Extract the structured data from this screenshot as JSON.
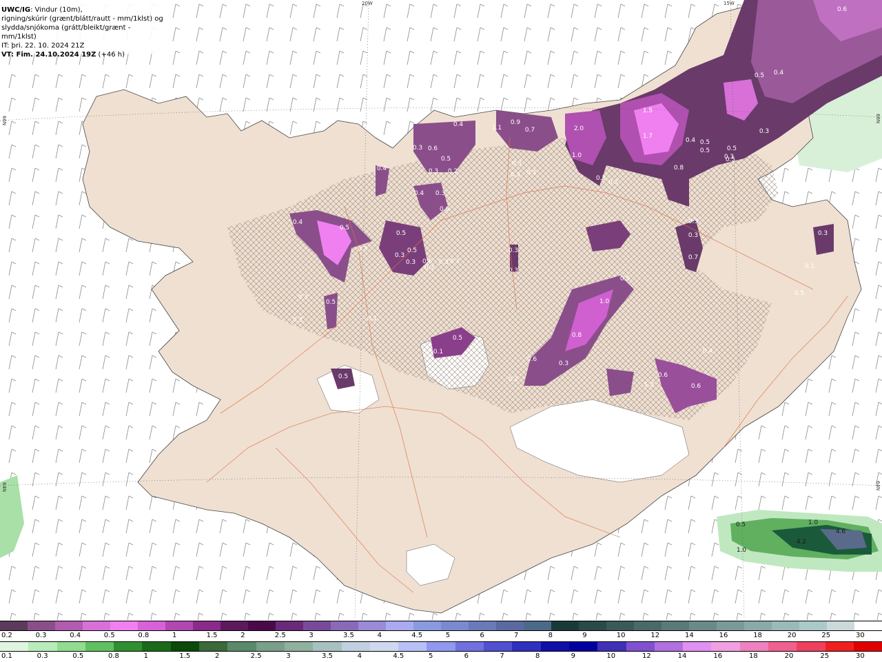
{
  "header": {
    "model": "UWC/IG",
    "line1_rest": ": Vindur (10m),",
    "line2": "rigning/skúrir (grænt/blátt/rautt - mm/1klst) og",
    "line3": "slydda/snjókoma (grátt/bleikt/grænt - mm/1klst)",
    "issue_time": "IT: þri. 22. 10. 2024 21Z",
    "valid_time": "VT: Fim. 24.10.2024 19Z",
    "lead": " (+46 h)"
  },
  "gridlabels": {
    "top_20w": "20W",
    "top_15w": "15W",
    "left_66n": "66N",
    "left_64n": "64N",
    "right_66n": "66N",
    "right_64n": "64N"
  },
  "map_labels": {
    "snow": [
      "0.6",
      "0.5",
      "0.4",
      "0.5",
      "0.3",
      "1.5",
      "1.7",
      "0.4",
      "0.5",
      "0.5",
      "0.5",
      "0.3",
      "0.8",
      "2.0",
      "1.0",
      "0.3",
      "0.3",
      "1.1",
      "0.9",
      "0.7",
      "0.4",
      "0.3",
      "0.3",
      "0.3",
      "0.3",
      "0.3",
      "0.7",
      "0.6",
      "0.5",
      "0.3",
      "0.3",
      "0.2",
      "0.4",
      "0.4",
      "0.3",
      "0.6",
      "0.5",
      "0.5",
      "0.3",
      "0.4",
      "0.5",
      "0.3",
      "0.3",
      "0.6",
      "0.3",
      "0.3",
      "0.5",
      "1.0",
      "0.8",
      "0.6",
      "0.2",
      "0.3",
      "0.1",
      "0.4",
      "1.2",
      "0.6",
      "0.6",
      "0.5",
      "0.5",
      "0.3",
      "0.3",
      "0.3",
      "0.1",
      "0.5",
      "0.1",
      "0.5",
      "0.3",
      "0.3",
      "0.3"
    ],
    "rain": [
      "0.5",
      "1.0",
      "4.2",
      "1.0",
      "4.6"
    ]
  },
  "legend_top": {
    "colors": [
      "#5c3a5c",
      "#8a4f8a",
      "#b05cb0",
      "#d870d8",
      "#f080f0",
      "#d860d8",
      "#b048b0",
      "#8a2a8a",
      "#5c1a5c",
      "#4a0a4a",
      "#6a2a7a",
      "#7a4a9a",
      "#8a6ab8",
      "#9a8ad8",
      "#aaaaf0",
      "#8a9ae0",
      "#7a8ad0",
      "#6a7ab8",
      "#5a6aa0",
      "#4a6a8a",
      "#1a3a3a",
      "#2a4a4a",
      "#3a5a5a",
      "#4a6a6a",
      "#5a7a7a",
      "#6a8a8a",
      "#7a9a9a",
      "#8aaaaa",
      "#9ababa",
      "#aacaca",
      "#cadada",
      "#ffffff"
    ],
    "labels": [
      "0.2",
      "0.3",
      "0.4",
      "0.5",
      "0.8",
      "1",
      "1.5",
      "2",
      "2.5",
      "3",
      "3.5",
      "4",
      "4.5",
      "5",
      "6",
      "7",
      "8",
      "9",
      "10",
      "12",
      "14",
      "16",
      "18",
      "20",
      "25",
      "30"
    ]
  },
  "legend_bottom": {
    "colors": [
      "#dff5df",
      "#b8ecb8",
      "#90dc90",
      "#60c060",
      "#309030",
      "#1a6a1a",
      "#0a4a0a",
      "#3a6a3a",
      "#5a8a6a",
      "#7aa08a",
      "#90b0a0",
      "#a8c0c0",
      "#c0d0e0",
      "#d0d8f0",
      "#b8c0f8",
      "#9098f0",
      "#7070e0",
      "#5050d0",
      "#3030c0",
      "#1010a8",
      "#0000a0",
      "#4030b8",
      "#8050d0",
      "#b070e0",
      "#e090f0",
      "#f0a0e0",
      "#f080c0",
      "#f06090",
      "#f04060",
      "#f02020",
      "#e00000"
    ],
    "labels": [
      "0.1",
      "0.3",
      "0.5",
      "0.8",
      "1",
      "1.5",
      "2",
      "2.5",
      "3",
      "3.5",
      "4",
      "4.5",
      "5",
      "6",
      "7",
      "8",
      "9",
      "10",
      "12",
      "14",
      "16",
      "18",
      "20",
      "25",
      "30"
    ]
  }
}
